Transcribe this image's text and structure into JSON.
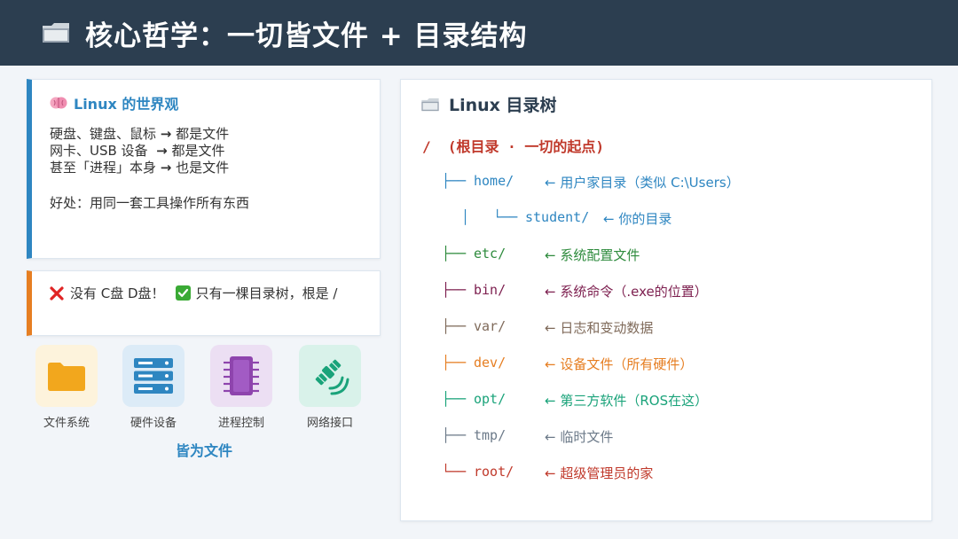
{
  "header": {
    "title": "核心哲学：一切皆文件 + 目录结构",
    "icon": "folder-icon"
  },
  "world_card": {
    "title": "Linux 的世界观",
    "lines": [
      {
        "text": "硬盘、键盘、鼠标",
        "result": "都是文件"
      },
      {
        "text": "网卡、USB 设备 ",
        "result": "都是文件"
      },
      {
        "text": "甚至「进程」本身",
        "result": "也是文件"
      }
    ],
    "benefit": "好处：用同一套工具操作所有东西",
    "accent": "#2e86c1"
  },
  "cdisk_card": {
    "no_text": "没有 C盘 D盘！",
    "yes_text": "只有一棵目录树，根是 /",
    "accent": "#e67e22"
  },
  "tiles": [
    {
      "label": "文件系统",
      "icon": "folder-icon",
      "bg": "#fdf3dc",
      "color": "#f2a71d"
    },
    {
      "label": "硬件设备",
      "icon": "server-icon",
      "bg": "#dcebf7",
      "color": "#2e86c1"
    },
    {
      "label": "进程控制",
      "icon": "chip-icon",
      "bg": "#ecdff3",
      "color": "#8e44ad"
    },
    {
      "label": "网络接口",
      "icon": "satellite-icon",
      "bg": "#d9f2ea",
      "color": "#1aa37a"
    }
  ],
  "tiles_caption": "皆为文件",
  "tree": {
    "title": "Linux 目录树",
    "root": "/  (根目录 · 一切的起点)",
    "root_color": "#c0392b",
    "entries": [
      {
        "branch": "├──",
        "name": "home/",
        "comment": "← 用户家目录（类似 C:\\Users）",
        "color": "#2e86c1"
      },
      {
        "branch": "│   └──",
        "name": "student/",
        "comment": "← 你的目录",
        "color": "#2e86c1"
      },
      {
        "branch": "├──",
        "name": "etc/",
        "comment": "← 系统配置文件",
        "color": "#2e8b3d"
      },
      {
        "branch": "├──",
        "name": "bin/",
        "comment": "← 系统命令（.exe的位置）",
        "color": "#7d1f4f"
      },
      {
        "branch": "├──",
        "name": "var/",
        "comment": "← 日志和变动数据",
        "color": "#7f6a5a"
      },
      {
        "branch": "├──",
        "name": "dev/",
        "comment": "← 设备文件（所有硬件）",
        "color": "#e67e22"
      },
      {
        "branch": "├──",
        "name": "opt/",
        "comment": "← 第三方软件（ROS在这）",
        "color": "#1aa37a"
      },
      {
        "branch": "├──",
        "name": "tmp/",
        "comment": "← 临时文件",
        "color": "#6c7a89"
      },
      {
        "branch": "└──",
        "name": "root/",
        "comment": "← 超级管理员的家",
        "color": "#c0392b"
      }
    ]
  }
}
